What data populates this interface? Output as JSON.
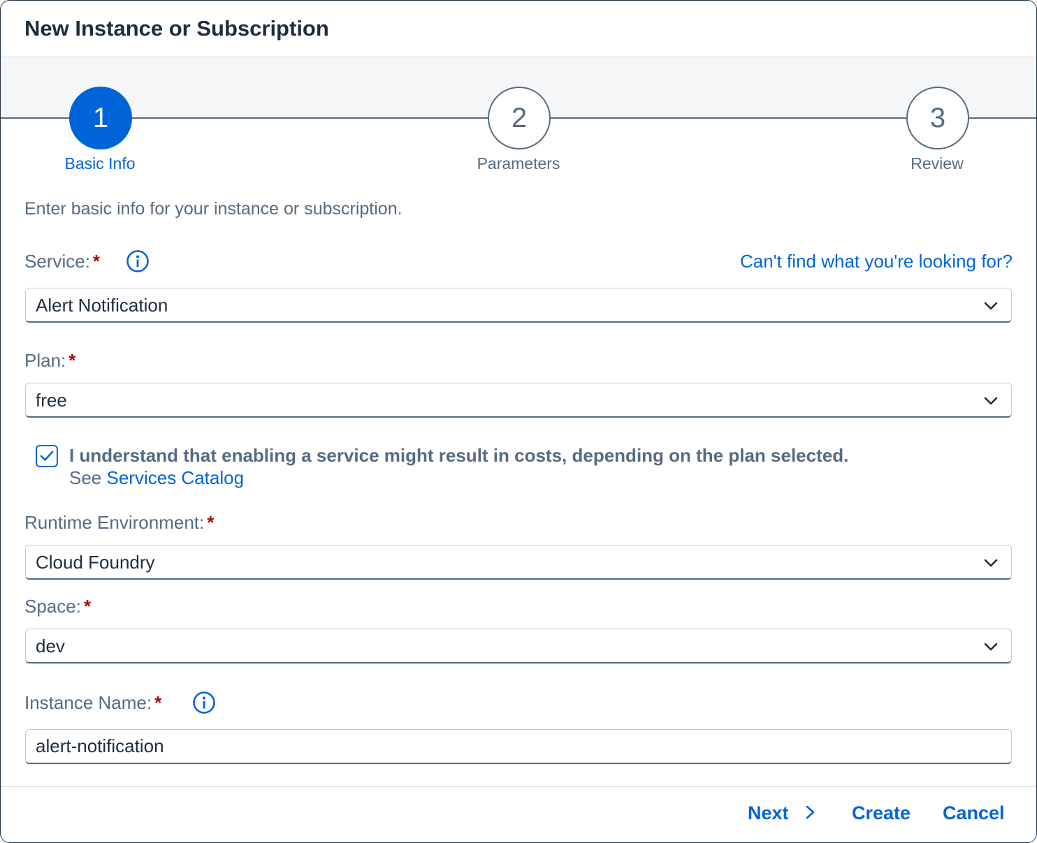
{
  "dialog": {
    "title": "New Instance or Subscription"
  },
  "wizard": {
    "steps": [
      {
        "number": "1",
        "label": "Basic Info",
        "state": "active"
      },
      {
        "number": "2",
        "label": "Parameters",
        "state": "inactive"
      },
      {
        "number": "3",
        "label": "Review",
        "state": "inactive"
      }
    ]
  },
  "form": {
    "intro": "Enter basic info for your instance or subscription.",
    "required_marker": "*",
    "help_link": "Can't find what you're looking for?",
    "service": {
      "label": "Service:",
      "value": "Alert Notification"
    },
    "plan": {
      "label": "Plan:",
      "value": "free"
    },
    "consent": {
      "checked": true,
      "text": "I understand that enabling a service might result in costs, depending on the plan selected.",
      "see_prefix": "See",
      "catalog_link": "Services Catalog"
    },
    "runtime": {
      "label": "Runtime Environment:",
      "value": "Cloud Foundry"
    },
    "space": {
      "label": "Space:",
      "value": "dev"
    },
    "instance_name": {
      "label": "Instance Name:",
      "value": "alert-notification"
    }
  },
  "footer": {
    "next": "Next",
    "create": "Create",
    "cancel": "Cancel"
  },
  "colors": {
    "accent": "#0064d9",
    "required": "#aa0808",
    "muted_text": "#556b82",
    "title": "#1d2d3e"
  }
}
